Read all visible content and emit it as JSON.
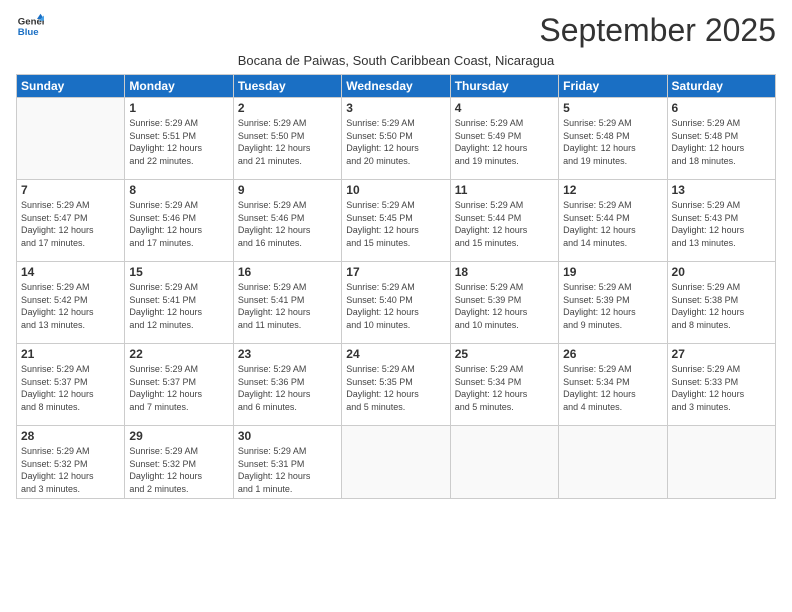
{
  "header": {
    "logo_general": "General",
    "logo_blue": "Blue",
    "month": "September 2025",
    "location": "Bocana de Paiwas, South Caribbean Coast, Nicaragua"
  },
  "weekdays": [
    "Sunday",
    "Monday",
    "Tuesday",
    "Wednesday",
    "Thursday",
    "Friday",
    "Saturday"
  ],
  "weeks": [
    [
      {
        "day": "",
        "info": ""
      },
      {
        "day": "1",
        "info": "Sunrise: 5:29 AM\nSunset: 5:51 PM\nDaylight: 12 hours\nand 22 minutes."
      },
      {
        "day": "2",
        "info": "Sunrise: 5:29 AM\nSunset: 5:50 PM\nDaylight: 12 hours\nand 21 minutes."
      },
      {
        "day": "3",
        "info": "Sunrise: 5:29 AM\nSunset: 5:50 PM\nDaylight: 12 hours\nand 20 minutes."
      },
      {
        "day": "4",
        "info": "Sunrise: 5:29 AM\nSunset: 5:49 PM\nDaylight: 12 hours\nand 19 minutes."
      },
      {
        "day": "5",
        "info": "Sunrise: 5:29 AM\nSunset: 5:48 PM\nDaylight: 12 hours\nand 19 minutes."
      },
      {
        "day": "6",
        "info": "Sunrise: 5:29 AM\nSunset: 5:48 PM\nDaylight: 12 hours\nand 18 minutes."
      }
    ],
    [
      {
        "day": "7",
        "info": "Sunrise: 5:29 AM\nSunset: 5:47 PM\nDaylight: 12 hours\nand 17 minutes."
      },
      {
        "day": "8",
        "info": "Sunrise: 5:29 AM\nSunset: 5:46 PM\nDaylight: 12 hours\nand 17 minutes."
      },
      {
        "day": "9",
        "info": "Sunrise: 5:29 AM\nSunset: 5:46 PM\nDaylight: 12 hours\nand 16 minutes."
      },
      {
        "day": "10",
        "info": "Sunrise: 5:29 AM\nSunset: 5:45 PM\nDaylight: 12 hours\nand 15 minutes."
      },
      {
        "day": "11",
        "info": "Sunrise: 5:29 AM\nSunset: 5:44 PM\nDaylight: 12 hours\nand 15 minutes."
      },
      {
        "day": "12",
        "info": "Sunrise: 5:29 AM\nSunset: 5:44 PM\nDaylight: 12 hours\nand 14 minutes."
      },
      {
        "day": "13",
        "info": "Sunrise: 5:29 AM\nSunset: 5:43 PM\nDaylight: 12 hours\nand 13 minutes."
      }
    ],
    [
      {
        "day": "14",
        "info": "Sunrise: 5:29 AM\nSunset: 5:42 PM\nDaylight: 12 hours\nand 13 minutes."
      },
      {
        "day": "15",
        "info": "Sunrise: 5:29 AM\nSunset: 5:41 PM\nDaylight: 12 hours\nand 12 minutes."
      },
      {
        "day": "16",
        "info": "Sunrise: 5:29 AM\nSunset: 5:41 PM\nDaylight: 12 hours\nand 11 minutes."
      },
      {
        "day": "17",
        "info": "Sunrise: 5:29 AM\nSunset: 5:40 PM\nDaylight: 12 hours\nand 10 minutes."
      },
      {
        "day": "18",
        "info": "Sunrise: 5:29 AM\nSunset: 5:39 PM\nDaylight: 12 hours\nand 10 minutes."
      },
      {
        "day": "19",
        "info": "Sunrise: 5:29 AM\nSunset: 5:39 PM\nDaylight: 12 hours\nand 9 minutes."
      },
      {
        "day": "20",
        "info": "Sunrise: 5:29 AM\nSunset: 5:38 PM\nDaylight: 12 hours\nand 8 minutes."
      }
    ],
    [
      {
        "day": "21",
        "info": "Sunrise: 5:29 AM\nSunset: 5:37 PM\nDaylight: 12 hours\nand 8 minutes."
      },
      {
        "day": "22",
        "info": "Sunrise: 5:29 AM\nSunset: 5:37 PM\nDaylight: 12 hours\nand 7 minutes."
      },
      {
        "day": "23",
        "info": "Sunrise: 5:29 AM\nSunset: 5:36 PM\nDaylight: 12 hours\nand 6 minutes."
      },
      {
        "day": "24",
        "info": "Sunrise: 5:29 AM\nSunset: 5:35 PM\nDaylight: 12 hours\nand 5 minutes."
      },
      {
        "day": "25",
        "info": "Sunrise: 5:29 AM\nSunset: 5:34 PM\nDaylight: 12 hours\nand 5 minutes."
      },
      {
        "day": "26",
        "info": "Sunrise: 5:29 AM\nSunset: 5:34 PM\nDaylight: 12 hours\nand 4 minutes."
      },
      {
        "day": "27",
        "info": "Sunrise: 5:29 AM\nSunset: 5:33 PM\nDaylight: 12 hours\nand 3 minutes."
      }
    ],
    [
      {
        "day": "28",
        "info": "Sunrise: 5:29 AM\nSunset: 5:32 PM\nDaylight: 12 hours\nand 3 minutes."
      },
      {
        "day": "29",
        "info": "Sunrise: 5:29 AM\nSunset: 5:32 PM\nDaylight: 12 hours\nand 2 minutes."
      },
      {
        "day": "30",
        "info": "Sunrise: 5:29 AM\nSunset: 5:31 PM\nDaylight: 12 hours\nand 1 minute."
      },
      {
        "day": "",
        "info": ""
      },
      {
        "day": "",
        "info": ""
      },
      {
        "day": "",
        "info": ""
      },
      {
        "day": "",
        "info": ""
      }
    ]
  ]
}
